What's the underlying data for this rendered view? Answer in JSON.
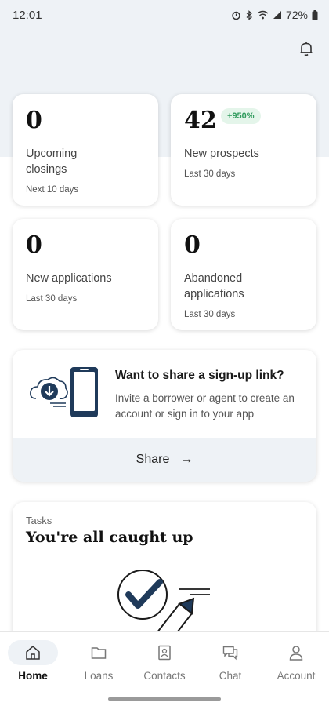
{
  "status_bar": {
    "time": "12:01",
    "battery": "72%"
  },
  "header": {
    "bell_icon": "notification-bell-icon"
  },
  "stats": [
    {
      "value": "0",
      "label": "Upcoming closings",
      "sub": "Next 10 days"
    },
    {
      "value": "42",
      "label": "New prospects",
      "sub": "Last 30 days",
      "badge": "+950%"
    },
    {
      "value": "0",
      "label": "New applications",
      "sub": "Last 30 days"
    },
    {
      "value": "0",
      "label": "Abandoned applications",
      "sub": "Last 30 days"
    }
  ],
  "share": {
    "title": "Want to share a sign-up link?",
    "description": "Invite a borrower or agent to create an account or sign in to your app",
    "button_label": "Share",
    "button_arrow": "→"
  },
  "tasks": {
    "label": "Tasks",
    "title": "You're all caught up"
  },
  "nav": {
    "items": [
      {
        "label": "Home",
        "icon": "home-icon"
      },
      {
        "label": "Loans",
        "icon": "folder-icon"
      },
      {
        "label": "Contacts",
        "icon": "contact-card-icon"
      },
      {
        "label": "Chat",
        "icon": "chat-bubble-icon"
      },
      {
        "label": "Account",
        "icon": "person-icon"
      }
    ]
  },
  "colors": {
    "hero_bg": "#eef2f6",
    "badge_bg": "#e4f5ea",
    "badge_text": "#2f9a5c",
    "illustration_navy": "#1f3a5a"
  }
}
